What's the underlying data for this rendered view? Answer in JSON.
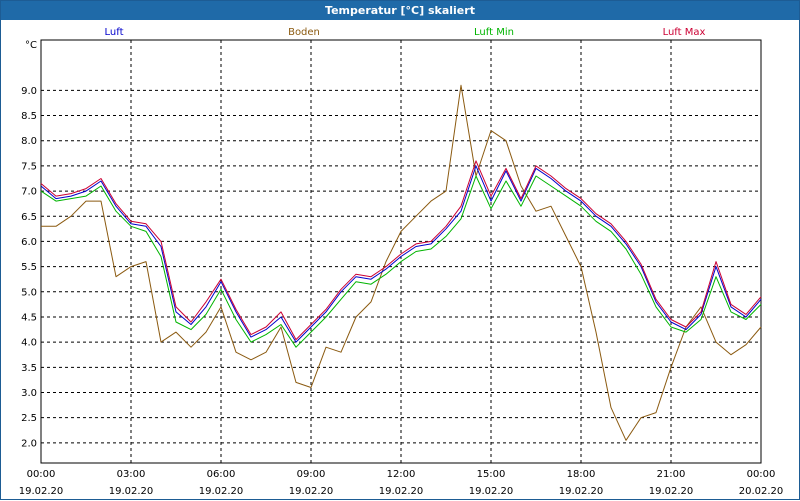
{
  "window": {
    "title": "Temperatur [°C] skaliert"
  },
  "chart_data": {
    "type": "line",
    "ylabel": "°C",
    "ylim": [
      1.6,
      10.0
    ],
    "yticks": [
      2.0,
      2.5,
      3.0,
      3.5,
      4.0,
      4.5,
      5.0,
      5.5,
      6.0,
      6.5,
      7.0,
      7.5,
      8.0,
      8.5,
      9.0
    ],
    "xlim": [
      "19.02.20 00:00",
      "20.02.20 00:00"
    ],
    "xticks": [
      {
        "time": "00:00",
        "date": "19.02.20"
      },
      {
        "time": "03:00",
        "date": "19.02.20"
      },
      {
        "time": "06:00",
        "date": "19.02.20"
      },
      {
        "time": "09:00",
        "date": "19.02.20"
      },
      {
        "time": "12:00",
        "date": "19.02.20"
      },
      {
        "time": "15:00",
        "date": "19.02.20"
      },
      {
        "time": "18:00",
        "date": "19.02.20"
      },
      {
        "time": "21:00",
        "date": "19.02.20"
      },
      {
        "time": "00:00",
        "date": "20.02.20"
      }
    ],
    "grid": true,
    "legend_position": "top",
    "x_hours": [
      0,
      0.5,
      1,
      1.5,
      2,
      2.5,
      3,
      3.5,
      4,
      4.5,
      5,
      5.5,
      6,
      6.5,
      7,
      7.5,
      8,
      8.5,
      9,
      9.5,
      10,
      10.5,
      11,
      11.5,
      12,
      12.5,
      13,
      13.5,
      14,
      14.5,
      15,
      15.5,
      16,
      16.5,
      17,
      17.5,
      18,
      18.5,
      19,
      19.5,
      20,
      20.5,
      21,
      21.5,
      22,
      22.5,
      23,
      23.5,
      24
    ],
    "series": [
      {
        "name": "Luft",
        "color": "#0000cc",
        "values": [
          7.1,
          6.85,
          6.9,
          7.0,
          7.2,
          6.7,
          6.35,
          6.3,
          5.9,
          4.6,
          4.35,
          4.7,
          5.2,
          4.6,
          4.1,
          4.25,
          4.5,
          4.0,
          4.3,
          4.6,
          5.0,
          5.3,
          5.25,
          5.45,
          5.7,
          5.9,
          5.95,
          6.25,
          6.6,
          7.5,
          6.8,
          7.4,
          6.8,
          7.45,
          7.25,
          7.0,
          6.8,
          6.5,
          6.3,
          5.95,
          5.5,
          4.8,
          4.4,
          4.25,
          4.55,
          5.5,
          4.7,
          4.5,
          4.85
        ]
      },
      {
        "name": "Boden",
        "color": "#8b5a10",
        "values": [
          6.3,
          6.3,
          6.5,
          6.8,
          6.8,
          5.3,
          5.5,
          5.6,
          4.0,
          4.2,
          3.9,
          4.2,
          4.7,
          3.8,
          3.65,
          3.8,
          4.3,
          3.2,
          3.1,
          3.9,
          3.8,
          4.5,
          4.8,
          5.6,
          6.2,
          6.5,
          6.8,
          7.0,
          9.1,
          7.3,
          8.2,
          8.0,
          7.1,
          6.6,
          6.7,
          6.1,
          5.5,
          4.2,
          2.7,
          2.05,
          2.5,
          2.6,
          3.5,
          4.3,
          4.7,
          4.0,
          3.75,
          3.95,
          4.3
        ]
      },
      {
        "name": "Luft Min",
        "color": "#00b400",
        "values": [
          7.0,
          6.8,
          6.85,
          6.9,
          7.1,
          6.6,
          6.3,
          6.2,
          5.7,
          4.4,
          4.25,
          4.55,
          5.05,
          4.45,
          4.0,
          4.15,
          4.35,
          3.9,
          4.2,
          4.5,
          4.85,
          5.2,
          5.15,
          5.35,
          5.6,
          5.8,
          5.85,
          6.1,
          6.45,
          7.3,
          6.65,
          7.2,
          6.7,
          7.3,
          7.1,
          6.9,
          6.7,
          6.4,
          6.2,
          5.85,
          5.35,
          4.7,
          4.3,
          4.2,
          4.45,
          5.3,
          4.6,
          4.45,
          4.75
        ]
      },
      {
        "name": "Luft Max",
        "color": "#cc0033",
        "values": [
          7.15,
          6.9,
          6.95,
          7.05,
          7.25,
          6.75,
          6.4,
          6.35,
          6.0,
          4.7,
          4.4,
          4.8,
          5.25,
          4.65,
          4.15,
          4.3,
          4.6,
          4.05,
          4.35,
          4.65,
          5.05,
          5.35,
          5.3,
          5.5,
          5.75,
          5.95,
          6.0,
          6.3,
          6.7,
          7.6,
          6.9,
          7.45,
          6.85,
          7.5,
          7.3,
          7.05,
          6.85,
          6.55,
          6.35,
          6.0,
          5.55,
          4.85,
          4.45,
          4.3,
          4.6,
          5.6,
          4.75,
          4.55,
          4.9
        ]
      }
    ]
  }
}
